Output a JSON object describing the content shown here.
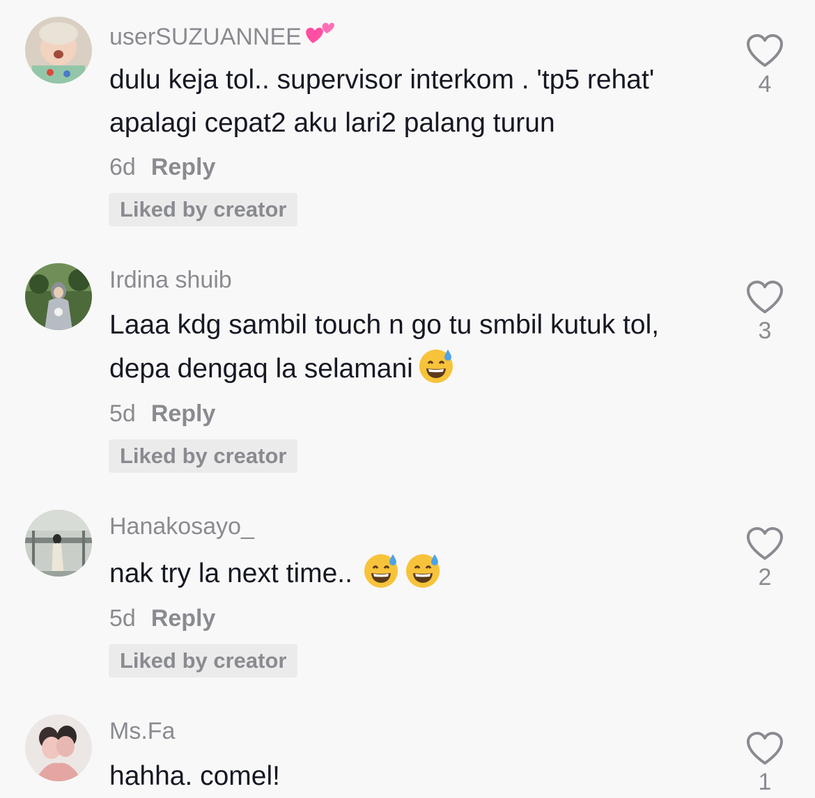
{
  "reply_label": "Reply",
  "liked_badge": "Liked by creator",
  "comments": [
    {
      "username": "userSUZUANNEE",
      "username_emoji": "two-hearts-icon",
      "text": "dulu keja tol.. supervisor interkom . 'tp5 rehat' apalagi cepat2 aku lari2 palang turun",
      "time": "6d",
      "likes": "4",
      "liked_by_creator": true
    },
    {
      "username": "Irdina shuib",
      "text": "Laaa kdg sambil touch n go tu smbil kutuk tol, depa dengaq la selamani",
      "emojis": [
        "grinning-sweat-icon"
      ],
      "time": "5d",
      "likes": "3",
      "liked_by_creator": true
    },
    {
      "username": "Hanakosayo_",
      "text": "nak try la next time..",
      "emojis": [
        "grinning-sweat-icon",
        "grinning-sweat-icon"
      ],
      "time": "5d",
      "likes": "2",
      "liked_by_creator": true
    },
    {
      "username": "Ms.Fa",
      "text": "hahha. comel!",
      "likes": "1"
    }
  ],
  "colors": {
    "background": "#f8f8f8",
    "secondary_text": "#8a8b91",
    "primary_text": "#161823",
    "badge_bg": "#ebebeb",
    "heart_emoji": "#ff4fa3",
    "sweat_emoji": "#f7c33a"
  }
}
